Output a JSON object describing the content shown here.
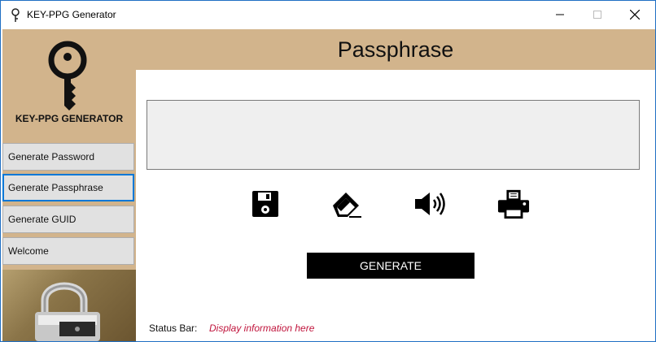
{
  "window": {
    "title": "KEY-PPG Generator",
    "icon": "key-icon",
    "controls": [
      "minimize-icon",
      "maximize-icon",
      "close-icon"
    ]
  },
  "sidebar": {
    "logo_icon": "key-icon",
    "brand": "KEY-PPG GENERATOR",
    "items": [
      {
        "label": "Generate Password"
      },
      {
        "label": "Generate Passphrase",
        "active": true
      },
      {
        "label": "Generate GUID"
      },
      {
        "label": "Welcome"
      }
    ],
    "image": "padlock-photo"
  },
  "header": {
    "title": "Passphrase"
  },
  "output": {
    "value": ""
  },
  "toolbar": {
    "icons": [
      "save-icon",
      "eraser-icon",
      "speaker-icon",
      "print-icon"
    ]
  },
  "actions": {
    "generate_label": "GENERATE"
  },
  "status": {
    "label": "Status Bar:",
    "text": "Display information here"
  },
  "colors": {
    "accent": "#d2b48c",
    "selection": "#0078d7",
    "status_text": "#c0143c"
  }
}
